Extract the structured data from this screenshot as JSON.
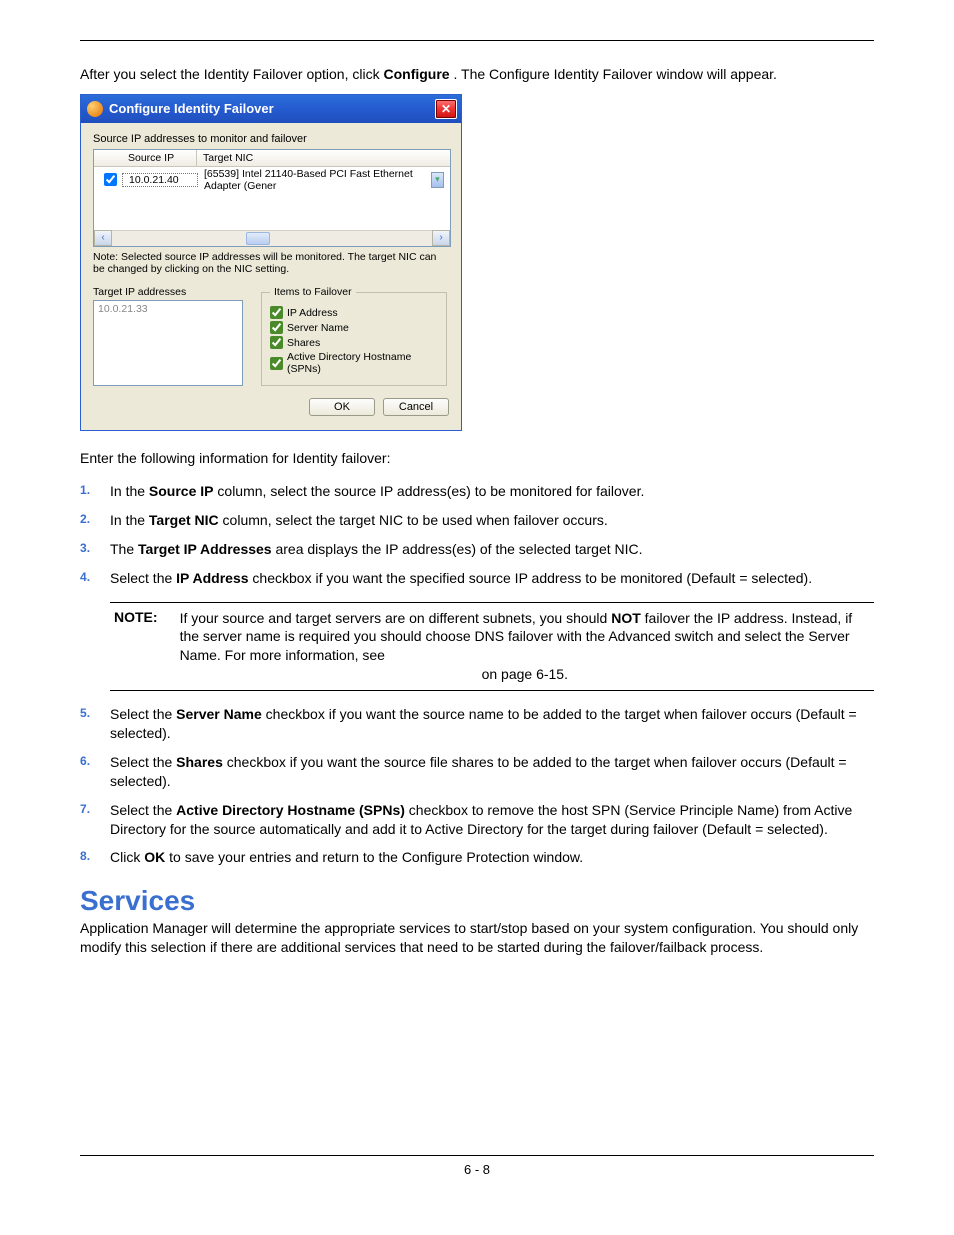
{
  "intro": {
    "before": "After you select the Identity Failover option, click ",
    "bold": "Configure",
    "after": ". The Configure Identity Failover window will appear."
  },
  "dialog": {
    "title": "Configure Identity Failover",
    "source_caption": "Source IP addresses to monitor and failover",
    "headers": {
      "source_ip": "Source IP",
      "target_nic": "Target NIC"
    },
    "row": {
      "checked": true,
      "ip": "10.0.21.40",
      "nic": "[65539] Intel 21140-Based PCI Fast Ethernet Adapter (Gener"
    },
    "note": "Note:  Selected source IP addresses will be monitored.  The target NIC can be changed by clicking on the NIC setting.",
    "target_label": "Target IP addresses",
    "target_value": "10.0.21.33",
    "items_legend": "Items to Failover",
    "items": {
      "ip": "IP Address",
      "server": "Server Name",
      "shares": "Shares",
      "spns": "Active Directory Hostname (SPNs)"
    },
    "ok": "OK",
    "cancel": "Cancel"
  },
  "after_dialog": "Enter the following information for Identity failover:",
  "steps": {
    "s1": {
      "a": "In the ",
      "b": "Source IP",
      "c": " column, select the source IP address(es) to be monitored for failover."
    },
    "s2": {
      "a": "In the ",
      "b": "Target NIC",
      "c": " column, select the target NIC to be used when failover occurs."
    },
    "s3": {
      "a": "The ",
      "b": "Target IP Addresses",
      "c": " area displays the IP address(es) of the selected target NIC."
    },
    "s4": {
      "a": "Select the ",
      "b": "IP Address",
      "c": " checkbox if you want the specified source IP address to be monitored (Default = selected)."
    },
    "note": {
      "label": "NOTE:",
      "t1": "If your source and target servers are on different subnets, you should ",
      "b1": "NOT",
      "t2": " failover the IP address. Instead, if the server name is required you should choose DNS failover with the Advanced switch and select the Server Name. For more information, see",
      "t3": " on page 6-15."
    },
    "s5": {
      "a": "Select the ",
      "b": "Server Name",
      "c": " checkbox if you want the source name to be added to the target when failover occurs (Default = selected)."
    },
    "s6": {
      "a": "Select the ",
      "b": "Shares",
      "c": " checkbox if you want the source file shares to be added to the target when failover occurs (Default = selected)."
    },
    "s7": {
      "a": "Select the ",
      "b": "Active Directory Hostname (SPNs)",
      "c": " checkbox to remove the host SPN (Service Principle Name) from Active Directory for the source automatically and add it to Active Directory for the target during failover (Default = selected)."
    },
    "s8": {
      "a": "Click ",
      "b": "OK",
      "c": " to save your entries and return to the Configure Protection window."
    }
  },
  "services": {
    "heading": "Services",
    "para": "Application Manager will determine the appropriate services to start/stop based on your system configuration. You should only modify this selection if there are additional services that need to be started during the failover/failback process."
  },
  "footer": "6 - 8"
}
